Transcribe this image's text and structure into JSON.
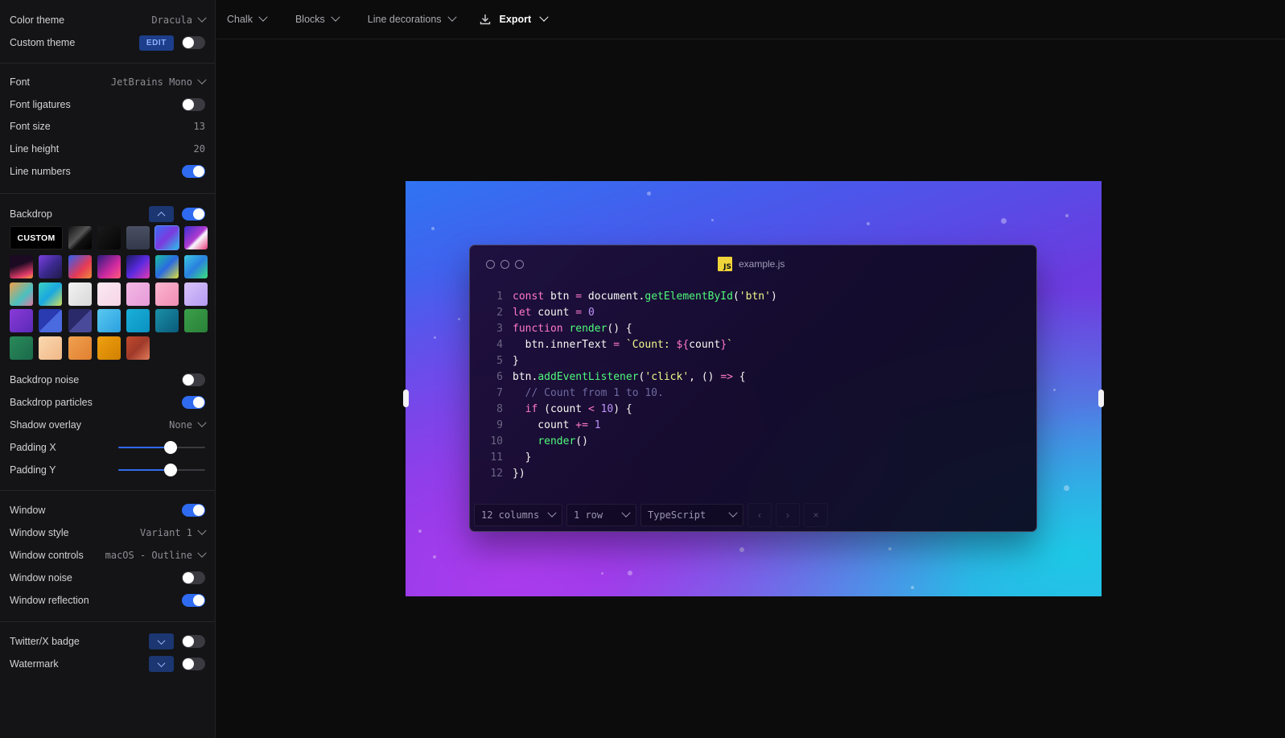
{
  "sidebar": {
    "color_theme": {
      "label": "Color theme",
      "value": "Dracula"
    },
    "custom_theme": {
      "label": "Custom theme",
      "edit": "EDIT",
      "enabled": false
    },
    "font": {
      "label": "Font",
      "value": "JetBrains Mono"
    },
    "font_ligatures": {
      "label": "Font ligatures",
      "enabled": false
    },
    "font_size": {
      "label": "Font size",
      "value": "13"
    },
    "line_height": {
      "label": "Line height",
      "value": "20"
    },
    "line_numbers": {
      "label": "Line numbers",
      "enabled": true
    },
    "backdrop": {
      "label": "Backdrop",
      "enabled": true,
      "custom_label": "CUSTOM"
    },
    "backdrop_noise": {
      "label": "Backdrop noise",
      "enabled": false
    },
    "backdrop_particles": {
      "label": "Backdrop particles",
      "enabled": true
    },
    "shadow_overlay": {
      "label": "Shadow overlay",
      "value": "None"
    },
    "padding_x": {
      "label": "Padding X",
      "fraction": 0.6
    },
    "padding_y": {
      "label": "Padding Y",
      "fraction": 0.6
    },
    "window": {
      "label": "Window",
      "enabled": true
    },
    "window_style": {
      "label": "Window style",
      "value": "Variant 1"
    },
    "window_controls": {
      "label": "Window controls",
      "value": "macOS - Outline"
    },
    "window_noise": {
      "label": "Window noise",
      "enabled": false
    },
    "window_reflection": {
      "label": "Window reflection",
      "enabled": true
    },
    "twitter_badge": {
      "label": "Twitter/X badge",
      "enabled": false
    },
    "watermark": {
      "label": "Watermark",
      "enabled": false
    }
  },
  "toolbar": {
    "chalk": "Chalk",
    "blocks": "Blocks",
    "line_decorations": "Line decorations",
    "export": "Export"
  },
  "window": {
    "filename": "example.js",
    "columns": "12 columns",
    "rows": "1 row",
    "language": "TypeScript"
  },
  "code": [
    {
      "n": "1"
    },
    {
      "n": "2"
    },
    {
      "n": "3"
    },
    {
      "n": "4"
    },
    {
      "n": "5"
    },
    {
      "n": "6"
    },
    {
      "n": "7"
    },
    {
      "n": "8"
    },
    {
      "n": "9"
    },
    {
      "n": "10"
    },
    {
      "n": "11"
    },
    {
      "n": "12"
    }
  ],
  "code_text": {
    "l1": [
      "const",
      " btn ",
      "=",
      " document.",
      "getElementById",
      "(",
      "'btn'",
      ")"
    ],
    "l2": [
      "let",
      " count ",
      "=",
      " ",
      "0"
    ],
    "l3": [
      "function",
      " ",
      "render",
      "() {"
    ],
    "l4": [
      "  btn.innerText ",
      "=",
      " `Count: ",
      "${",
      "count",
      "}",
      "`"
    ],
    "l5": [
      "}"
    ],
    "l6": [
      "btn.",
      "addEventListener",
      "(",
      "'click'",
      ", () ",
      "=>",
      " {"
    ],
    "l7": [
      "  // Count from 1 to 10."
    ],
    "l8": [
      "  ",
      "if",
      " (count ",
      "<",
      " ",
      "10",
      ") {"
    ],
    "l9": [
      "    count ",
      "+=",
      " ",
      "1"
    ],
    "l10": [
      "    ",
      "render",
      "()"
    ],
    "l11": [
      "  }"
    ],
    "l12": [
      "})"
    ]
  }
}
